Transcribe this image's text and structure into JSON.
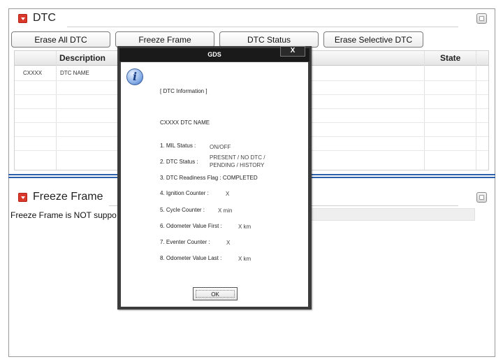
{
  "dtc_section": {
    "title": "DTC",
    "buttons": {
      "erase_all": "Erase All DTC",
      "freeze_frame": "Freeze Frame",
      "dtc_status": "DTC Status",
      "erase_selective": "Erase Selective DTC"
    },
    "table": {
      "columns": {
        "description": "Description",
        "state": "State"
      },
      "rows": [
        {
          "code": "CXXXX",
          "name": "DTC NAME"
        }
      ]
    }
  },
  "freeze_frame_section": {
    "title": "Freeze Frame",
    "message": "Freeze Frame is NOT suppo"
  },
  "dialog": {
    "title": "GDS",
    "close_label": "X",
    "header": "[ DTC Information ]",
    "dtc_line": "CXXXX DTC NAME",
    "items": [
      {
        "label": "1. MIL Status :",
        "value": "ON/OFF"
      },
      {
        "label": "2. DTC Status :",
        "value": "PRESENT / NO DTC /",
        "value2": "PENDING / HISTORY"
      },
      {
        "label": "3. DTC Readiness Flag : COMPLETED",
        "value": ""
      },
      {
        "label": "4. Ignition Counter :",
        "value": "X"
      },
      {
        "label": "5. Cycle Counter :",
        "value": "X min"
      },
      {
        "label": "6. Odometer Value First :",
        "value": "X km"
      },
      {
        "label": "7. Eventer Counter :",
        "value": "X"
      },
      {
        "label": "8. Odometer Value Last :",
        "value": "X km"
      }
    ],
    "ok_label": "OK"
  },
  "colors": {
    "accent_red": "#d9382b",
    "divider_blue": "#2d5fa8",
    "dialog_titlebar": "#1a1a1a"
  }
}
